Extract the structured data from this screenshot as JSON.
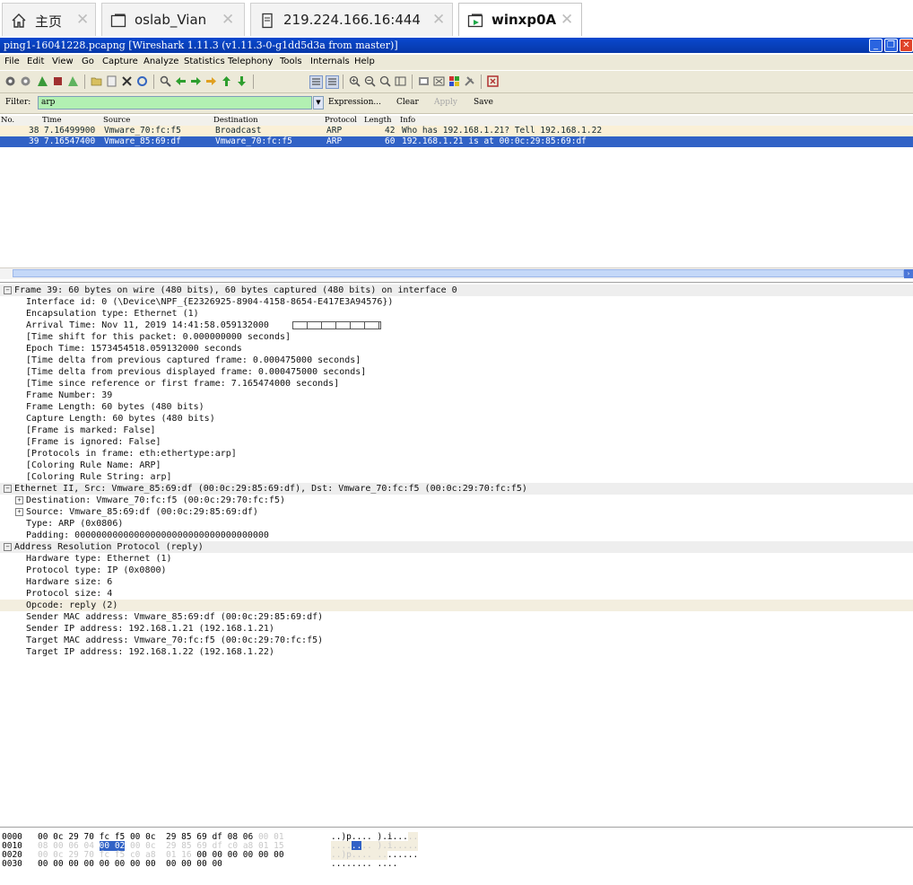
{
  "browser": {
    "tabs": [
      {
        "label": "主页",
        "icon": "home-icon"
      },
      {
        "label": "oslab_Vian",
        "icon": "window-icon"
      },
      {
        "label": "219.224.166.16:444",
        "icon": "document-icon"
      },
      {
        "label": "winxp0A",
        "icon": "remote-window-icon"
      }
    ],
    "active_tab": 3,
    "close_glyph": "✕"
  },
  "window": {
    "title": "ping1-16041228.pcapng   [Wireshark 1.11.3  (v1.11.3-0-g1dd5d3a from master)]"
  },
  "menu": {
    "items": [
      "File",
      "Edit",
      "View",
      "Go",
      "Capture",
      "Analyze",
      "Statistics",
      "Telephony",
      "Tools",
      "Internals",
      "Help"
    ]
  },
  "filter": {
    "label": "Filter:",
    "value": "arp",
    "expression": "Expression...",
    "clear": "Clear",
    "apply": "Apply",
    "save": "Save"
  },
  "packet_list": {
    "columns": [
      "No.",
      "Time",
      "Source",
      "Destination",
      "Protocol",
      "Length",
      "Info"
    ],
    "rows": [
      {
        "no": "38",
        "time": "7.16499900",
        "source": "Vmware_70:fc:f5",
        "destination": "Broadcast",
        "protocol": "ARP",
        "length": "42",
        "info": "Who has 192.168.1.21?  Tell 192.168.1.22"
      },
      {
        "no": "39",
        "time": "7.16547400",
        "source": "Vmware_85:69:df",
        "destination": "Vmware_70:fc:f5",
        "protocol": "ARP",
        "length": "60",
        "info": "192.168.1.21 is at 00:0c:29:85:69:df"
      }
    ],
    "selected_row": 1
  },
  "details": {
    "frame_header": "Frame 39: 60 bytes on wire (480 bits), 60 bytes captured (480 bits) on interface 0",
    "frame_lines": [
      "Interface id: 0 (\\Device\\NPF_{E2326925-8904-4158-8654-E417E3A94576})",
      "Encapsulation type: Ethernet (1)",
      "Arrival Time: Nov 11, 2019 14:41:58.059132000",
      "[Time shift for this packet: 0.000000000 seconds]",
      "Epoch Time: 1573454518.059132000 seconds",
      "[Time delta from previous captured frame: 0.000475000 seconds]",
      "[Time delta from previous displayed frame: 0.000475000 seconds]",
      "[Time since reference or first frame: 7.165474000 seconds]",
      "Frame Number: 39",
      "Frame Length: 60 bytes (480 bits)",
      "Capture Length: 60 bytes (480 bits)",
      "[Frame is marked: False]",
      "[Frame is ignored: False]",
      "[Protocols in frame: eth:ethertype:arp]",
      "[Coloring Rule Name: ARP]",
      "[Coloring Rule String: arp]"
    ],
    "eth_header": "Ethernet II, Src: Vmware_85:69:df (00:0c:29:85:69:df), Dst: Vmware_70:fc:f5 (00:0c:29:70:fc:f5)",
    "eth_dest": "Destination: Vmware_70:fc:f5 (00:0c:29:70:fc:f5)",
    "eth_src": "Source: Vmware_85:69:df (00:0c:29:85:69:df)",
    "eth_type": "Type: ARP (0x0806)",
    "eth_padding": "Padding: 000000000000000000000000000000000000",
    "arp_header": "Address Resolution Protocol (reply)",
    "arp_lines": [
      "Hardware type: Ethernet (1)",
      "Protocol type: IP (0x0800)",
      "Hardware size: 6",
      "Protocol size: 4",
      "Opcode: reply (2)",
      "Sender MAC address: Vmware_85:69:df (00:0c:29:85:69:df)",
      "Sender IP address: 192.168.1.21 (192.168.1.21)",
      "Target MAC address: Vmware_70:fc:f5 (00:0c:29:70:fc:f5)",
      "Target IP address: 192.168.1.22 (192.168.1.22)"
    ],
    "selected_arp_line": 4
  },
  "hex": {
    "offsets": [
      "0000",
      "0010",
      "0020",
      "0030"
    ],
    "r0_a": "00 0c 29 70 fc f5 00 0c  29 85 69 df 08 06",
    "r0_g": " 00 01",
    "r1_g1": "08 00 06 04",
    "r1_h": "00 02",
    "r1_g2": "00 0c  29 85 69 df c0 a8 01 15",
    "r2_g": "00 0c 29 70 fc f5 c0 a8  01 16",
    "r2_b": " 00 00 00 00 00 00",
    "r3": "00 00 00 00 00 00 00 00  00 00 00 00",
    "a0_n": "..)p.... ).i...",
    "a0_g": "..",
    "a1_g1": "....",
    "a1_h": "..",
    "a1_g2": ".. ).i.....",
    "a2_g": "..)p.... ..",
    "a2_n": "......",
    "a3": "........ ...."
  }
}
